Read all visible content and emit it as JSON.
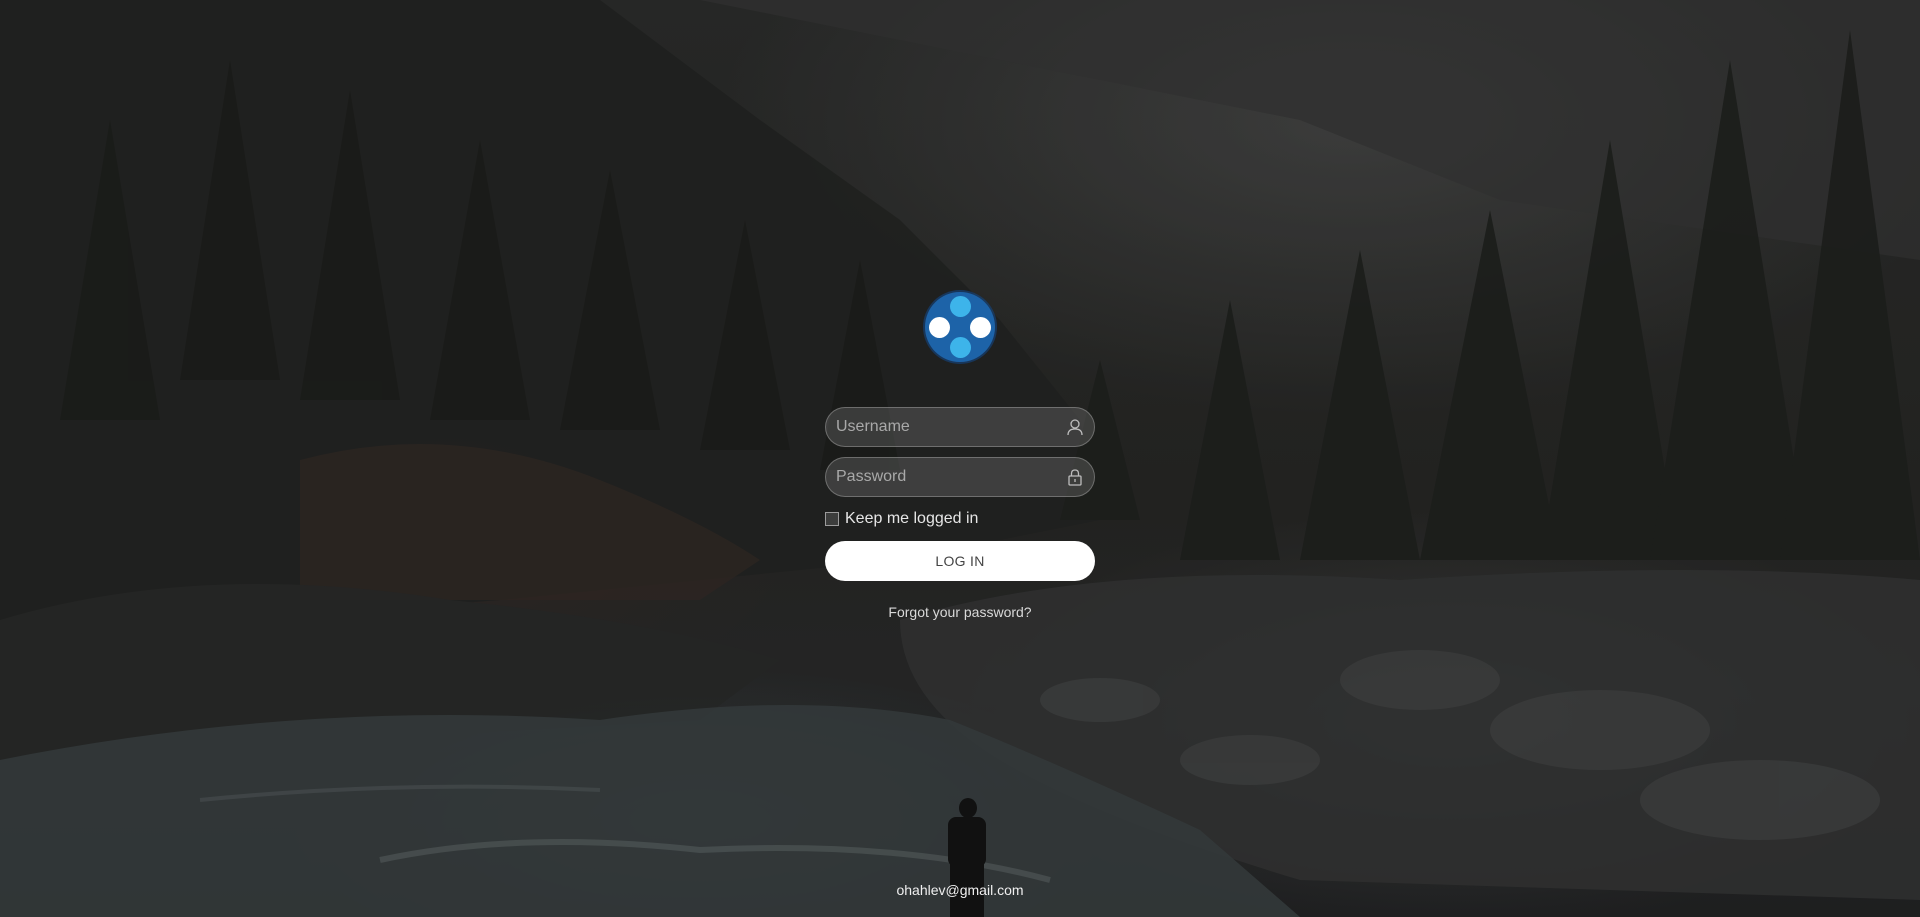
{
  "login": {
    "username_placeholder": "Username",
    "username_value": "",
    "password_placeholder": "Password",
    "password_value": "",
    "remember_label": "Keep me logged in",
    "remember_checked": false,
    "submit_label": "LOG IN",
    "forgot_label": "Forgot your password?",
    "icons": {
      "username": "user-icon",
      "password": "lock-icon"
    }
  },
  "logo": {
    "name": "app-logo",
    "colors": {
      "ring": "#1d63a8",
      "accent": "#3db4ea",
      "light": "#ffffff"
    }
  },
  "footer": {
    "email": "ohahlev@gmail.com"
  }
}
